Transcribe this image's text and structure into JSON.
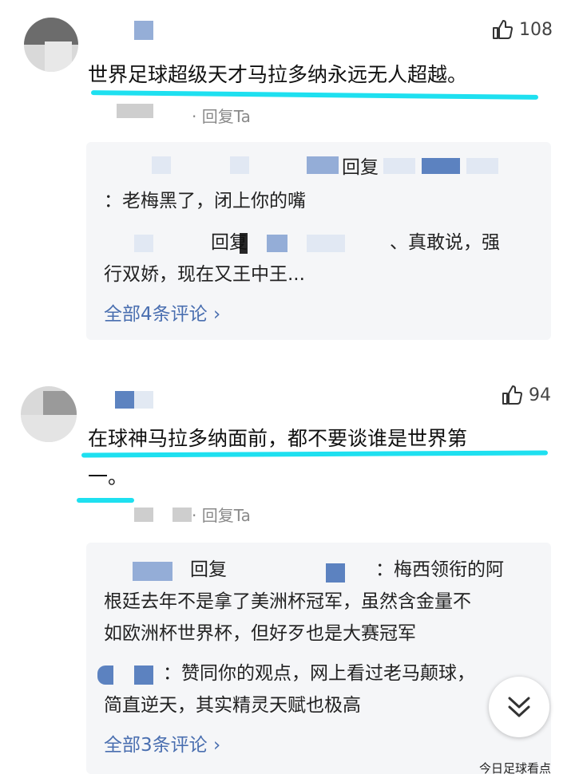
{
  "comments": [
    {
      "likes": "108",
      "text": "世界足球超级天才马拉多纳永远无人超越。",
      "reply_action": "· 回复Ta",
      "replies": {
        "line1_prefix": "回复",
        "line2": "：老梅黑了，闭上你的嘴",
        "line3_prefix": "回复",
        "line3_text": "、真敢说，强",
        "line4": "行双娇，现在又王中王...",
        "more": "全部4条评论 ›"
      }
    },
    {
      "likes": "94",
      "text_line1": "在球神马拉多纳面前，都不要谈谁是世界第",
      "text_line2": "一。",
      "reply_action": "· 回复Ta",
      "replies": {
        "line1_prefix": "回复",
        "line1_text": "：梅西领衔的阿",
        "line2": "根廷去年不是拿了美洲杯冠军，虽然含金量不",
        "line3": "如欧洲杯世界杯，但好歹也是大赛冠军",
        "line4_text": "：赞同你的观点，网上看过老马颠球，",
        "line5": "简直逆天，其实精灵天赋也极高",
        "more": "全部3条评论 ›"
      }
    }
  ],
  "watermark": "今日足球看点",
  "icons": {
    "like": "thumbs-up-icon",
    "scroll": "double-chevron-down-icon"
  },
  "colors": {
    "underline": "#1ee0f0",
    "link": "#4a6fb0"
  }
}
